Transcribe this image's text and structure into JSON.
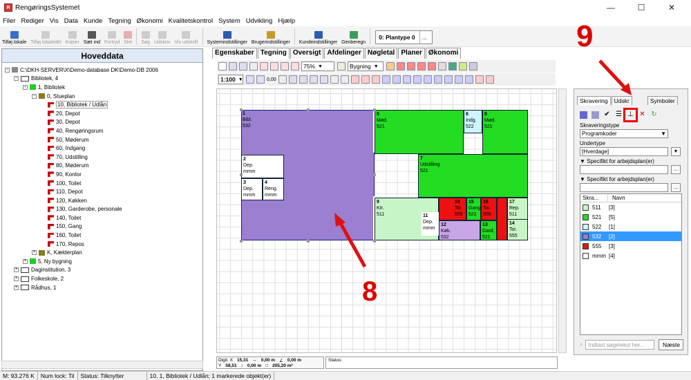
{
  "window": {
    "title": "RengøringsSystemet",
    "app_icon_text": "R",
    "minimize": "—",
    "maximize": "☐",
    "close": "✕"
  },
  "menu": [
    "Filer",
    "Rediger",
    "Vis",
    "Data",
    "Kunde",
    "Tegning",
    "Økonomi",
    "Kvalitetskontrol",
    "System",
    "Udvikling",
    "Hjælp"
  ],
  "toolbar": {
    "buttons": [
      {
        "label": "Tilføj lokale",
        "enabled": true,
        "color": "#3a6fc9"
      },
      {
        "label": "Tilføj lokaledel",
        "enabled": false,
        "color": "#888"
      },
      {
        "label": "Kopier",
        "enabled": false,
        "color": "#888"
      },
      {
        "label": "Sæt ind",
        "enabled": true,
        "color": "#555"
      },
      {
        "label": "Fortryd",
        "enabled": false,
        "color": "#888"
      },
      {
        "label": "Slet",
        "enabled": false,
        "color": "#c33"
      },
      {
        "label": "Søg",
        "enabled": false,
        "color": "#888"
      },
      {
        "label": "Udskriv",
        "enabled": false,
        "color": "#888"
      },
      {
        "label": "Vis udskrift",
        "enabled": false,
        "color": "#888"
      },
      {
        "label": "Systemindstillinger",
        "enabled": true,
        "color": "#2a5db0"
      },
      {
        "label": "Brugerindstillinger",
        "enabled": true,
        "color": "#c79a2a"
      },
      {
        "label": "Kundeindstillinger",
        "enabled": true,
        "color": "#2a5db0"
      },
      {
        "label": "Genberegn",
        "enabled": true,
        "color": "#3a9b5a"
      }
    ],
    "plantype": "0: Plantype 0",
    "plantype_btn": "..."
  },
  "left_panel": {
    "title": "Hoveddata",
    "tree": [
      {
        "level": 0,
        "exp": "-",
        "icon": "server",
        "label": "C:\\DKH-SERVER\\X\\Demo-database DK\\Demo-DB 2006"
      },
      {
        "level": 1,
        "exp": "-",
        "icon": "building",
        "label": "Bibliotek, 4"
      },
      {
        "level": 2,
        "exp": "-",
        "icon": "green",
        "label": "1, Bibliotek"
      },
      {
        "level": 3,
        "exp": "-",
        "icon": "olive",
        "label": "0, Stueplan"
      },
      {
        "level": 4,
        "exp": "",
        "icon": "room",
        "label": "10, Bibliotek / Udlån"
      },
      {
        "level": 4,
        "exp": "",
        "icon": "room",
        "label": "20, Depot"
      },
      {
        "level": 4,
        "exp": "",
        "icon": "room",
        "label": "30, Depot"
      },
      {
        "level": 4,
        "exp": "",
        "icon": "room",
        "label": "40, Rengøringsrum"
      },
      {
        "level": 4,
        "exp": "",
        "icon": "room",
        "label": "50, Møderum"
      },
      {
        "level": 4,
        "exp": "",
        "icon": "room",
        "label": "60, Indgang"
      },
      {
        "level": 4,
        "exp": "",
        "icon": "room",
        "label": "70, Udstilling"
      },
      {
        "level": 4,
        "exp": "",
        "icon": "room",
        "label": "80, Møderum"
      },
      {
        "level": 4,
        "exp": "",
        "icon": "room",
        "label": "90, Kontor"
      },
      {
        "level": 4,
        "exp": "",
        "icon": "room",
        "label": "100, Toilet"
      },
      {
        "level": 4,
        "exp": "",
        "icon": "room",
        "label": "110, Depot"
      },
      {
        "level": 4,
        "exp": "",
        "icon": "room",
        "label": "120, Køkken"
      },
      {
        "level": 4,
        "exp": "",
        "icon": "room",
        "label": "130, Garderobe, personale"
      },
      {
        "level": 4,
        "exp": "",
        "icon": "room",
        "label": "140, Toilet"
      },
      {
        "level": 4,
        "exp": "",
        "icon": "room",
        "label": "150, Gang"
      },
      {
        "level": 4,
        "exp": "",
        "icon": "room",
        "label": "160, Toilet"
      },
      {
        "level": 4,
        "exp": "",
        "icon": "room",
        "label": "170, Repos"
      },
      {
        "level": 3,
        "exp": "+",
        "icon": "olive",
        "label": "K, Kælderplan"
      },
      {
        "level": 2,
        "exp": "+",
        "icon": "green",
        "label": "5, Ny bygning"
      },
      {
        "level": 1,
        "exp": "+",
        "icon": "building",
        "label": "Daginstitution, 3"
      },
      {
        "level": 1,
        "exp": "+",
        "icon": "building",
        "label": "Folkeskole, 2"
      },
      {
        "level": 1,
        "exp": "+",
        "icon": "building",
        "label": "Rådhus, 1"
      }
    ]
  },
  "tabs": [
    "Egenskaber",
    "Tegning",
    "Oversigt",
    "Afdelinger",
    "Nøgletal",
    "Planer",
    "Økonomi"
  ],
  "active_tab": "Tegning",
  "drawing_toolbar": {
    "zoom": "75%",
    "layer": "Bygning",
    "scale": "1:100",
    "thickness": "0,00"
  },
  "rooms": [
    {
      "num": "1",
      "name": "Bibl.",
      "code": "532",
      "color": "#9b7fd0"
    },
    {
      "num": "5",
      "name": "Mød.",
      "code": "521",
      "color": "#22dd22"
    },
    {
      "num": "6",
      "name": "Indg.",
      "code": "522",
      "color": "#ccf5ff"
    },
    {
      "num": "8",
      "name": "Mød.",
      "code": "521",
      "color": "#22dd22"
    },
    {
      "num": "7",
      "name": "Udstilling",
      "code": "521",
      "color": "#22dd22"
    },
    {
      "num": "2",
      "name": "Dep.",
      "code": "mmm",
      "color": "#ffffff"
    },
    {
      "num": "3",
      "name": "Dep.",
      "code": "mmm",
      "color": "#ffffff"
    },
    {
      "num": "4",
      "name": "Reng.",
      "code": "mmm",
      "color": "#ffffff"
    },
    {
      "num": "9",
      "name": "Ktr.",
      "code": "511",
      "color": "#c8f5c8"
    },
    {
      "num": "10",
      "name": "Toi.",
      "code": "555",
      "color": "#ee1111"
    },
    {
      "num": "15",
      "name": "Gang",
      "code": "521",
      "color": "#22dd22"
    },
    {
      "num": "16",
      "name": "Toi.",
      "code": "555",
      "color": "#ee1111"
    },
    {
      "num": "17",
      "name": "Rep.",
      "code": "511",
      "color": "#c8f5c8"
    },
    {
      "num": "14",
      "name": "Toi.",
      "code": "555",
      "color": "#c8f5c8"
    },
    {
      "num": "11",
      "name": "Dep.",
      "code": "mmm",
      "color": "#ffffff"
    },
    {
      "num": "12",
      "name": "Køk.",
      "code": "532",
      "color": "#c9a6e8"
    },
    {
      "num": "13",
      "name": "Gard.",
      "code": "521",
      "color": "#22dd22"
    }
  ],
  "coords": {
    "x": "15,31",
    "y": "58,51",
    "dx": "0,00 m",
    "dy": "0,00 m",
    "angle": "0,00 m",
    "area": "205,20 m²"
  },
  "status_label": "Status:",
  "right_panel": {
    "tabs": [
      "Skravering",
      "Udskr",
      "Symboler"
    ],
    "skravering_label": "Skraveringstype",
    "skravering_value": "Programkoder",
    "undertype_label": "Undertype",
    "undertype_value": "[Hverdage]",
    "spec1": "Specifikt for arbejdsplan(er)",
    "spec2": "Specifikt for arbejdsplan(er)",
    "legend_head": [
      "Skra...",
      "Navn"
    ],
    "legend": [
      {
        "code": "511",
        "count": "[3]",
        "color": "#c8f5c8"
      },
      {
        "code": "521",
        "count": "[5]",
        "color": "#22dd22"
      },
      {
        "code": "522",
        "count": "[1]",
        "color": "#ccf5ff"
      },
      {
        "code": "532",
        "count": "[2]",
        "color": "#9b7fd0"
      },
      {
        "code": "555",
        "count": "[3]",
        "color": "#ee1111"
      },
      {
        "code": "mmm",
        "count": "[4]",
        "color": "#ffffff"
      }
    ],
    "search_placeholder": "Indtast søgetekst her...",
    "next_button": "Næste"
  },
  "statusbar": [
    "M: 93.276 K",
    "Num lock: Til",
    "Status: Tilknytter",
    "10, 1, Bibliotek / Udlån; 1 markerede objekt(er)"
  ],
  "annotations": {
    "eight": "8",
    "nine": "9"
  }
}
